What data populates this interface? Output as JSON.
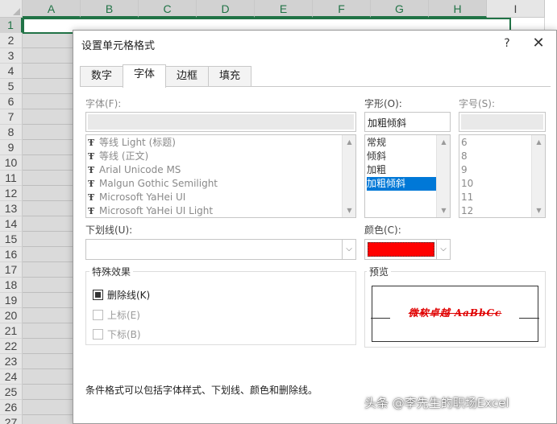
{
  "sheet": {
    "columns": [
      "A",
      "B",
      "C",
      "D",
      "E",
      "F",
      "G",
      "H",
      "I"
    ],
    "rows": [
      "1",
      "2",
      "3",
      "4",
      "5",
      "6",
      "7",
      "8",
      "9",
      "10",
      "11",
      "12",
      "13",
      "14",
      "15",
      "16",
      "17",
      "18",
      "19",
      "20",
      "21",
      "22",
      "23",
      "24",
      "25",
      "26",
      "27"
    ]
  },
  "dialog": {
    "title": "设置单元格格式",
    "help": "?",
    "close": "✕",
    "tabs": [
      {
        "label": "数字"
      },
      {
        "label": "字体"
      },
      {
        "label": "边框"
      },
      {
        "label": "填充"
      }
    ],
    "active_tab": "字体",
    "font": {
      "label": "字体(F):",
      "value": "",
      "items": [
        "等线 Light (标题)",
        "等线 (正文)",
        "Arial Unicode MS",
        "Malgun Gothic Semilight",
        "Microsoft YaHei UI",
        "Microsoft YaHei UI Light"
      ]
    },
    "style": {
      "label": "字形(O):",
      "value": "加粗倾斜",
      "items": [
        "常规",
        "倾斜",
        "加粗",
        "加粗倾斜"
      ],
      "selected": "加粗倾斜"
    },
    "size": {
      "label": "字号(S):",
      "value": "",
      "items": [
        "6",
        "8",
        "9",
        "10",
        "11",
        "12"
      ]
    },
    "underline": {
      "label": "下划线(U):",
      "value": ""
    },
    "color": {
      "label": "颜色(C):",
      "value": "#ff0000"
    },
    "effects": {
      "title": "特殊效果",
      "strikethrough": {
        "label": "删除线(K)",
        "checked": true
      },
      "superscript": {
        "label": "上标(E)",
        "checked": false
      },
      "subscript": {
        "label": "下标(B)",
        "checked": false
      }
    },
    "preview": {
      "title": "预览",
      "text": "微软卓越  AaBbCc"
    },
    "hint": "条件格式可以包括字体样式、下划线、颜色和删除线。"
  },
  "watermark": "头条 @李先生的职场Excel",
  "colors": {
    "accent": "#0078d7",
    "excel_green": "#217346",
    "preview_red": "#e00000"
  }
}
